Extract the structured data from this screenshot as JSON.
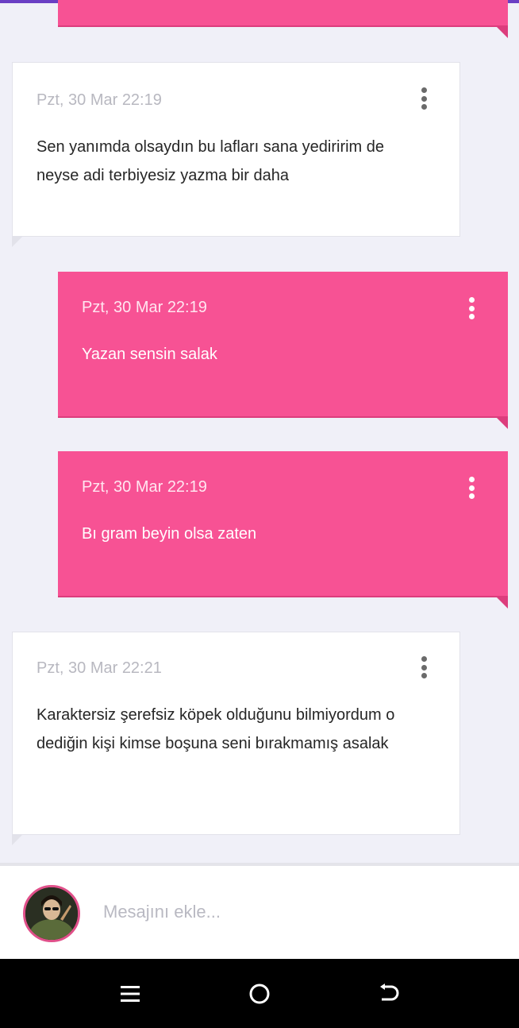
{
  "messages": [
    {
      "side": "received",
      "time": "Pzt, 30 Mar 22:19",
      "text": "Sen yanımda olsaydın bu lafları sana yediririm de neyse adi terbiyesiz yazma bir daha"
    },
    {
      "side": "sent",
      "time": "Pzt, 30 Mar 22:19",
      "text": "Yazan sensin salak"
    },
    {
      "side": "sent",
      "time": "Pzt, 30 Mar 22:19",
      "text": "Bı gram beyin olsa zaten"
    },
    {
      "side": "received",
      "time": "Pzt, 30 Mar 22:21",
      "text": "Karaktersiz şerefsiz köpek olduğunu bilmiyordum o dediğin kişi kimse boşuna seni bırakmamış asalak"
    }
  ],
  "composer": {
    "placeholder": "Mesajını ekle..."
  },
  "icons": {
    "more": "more-vertical-icon",
    "menu": "menu-icon",
    "home": "home-icon",
    "back": "back-icon"
  },
  "colors": {
    "sent_bubble": "#f75294",
    "received_bubble": "#ffffff",
    "accent": "#6a3fc4"
  }
}
